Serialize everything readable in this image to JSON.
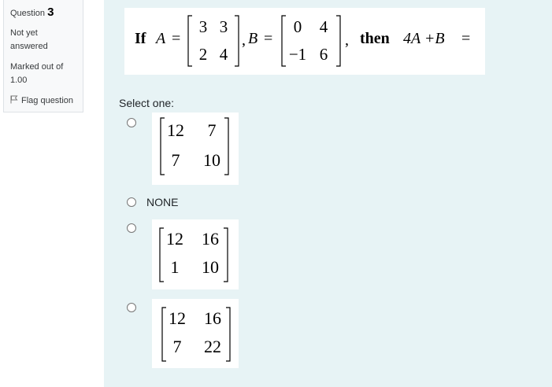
{
  "info": {
    "question_label": "Question",
    "question_number": "3",
    "state_line1": "Not yet",
    "state_line2": "answered",
    "grade_line1": "Marked out of",
    "grade_line2": "1.00",
    "flag_label": "Flag question"
  },
  "question": {
    "if_word": "If",
    "var_a": "A",
    "eq": "=",
    "matrix_a": [
      [
        "3",
        "3"
      ],
      [
        "2",
        "4"
      ]
    ],
    "comma_b": ",",
    "var_b": "B",
    "matrix_b": [
      [
        "0",
        "4"
      ],
      [
        "−1",
        "6"
      ]
    ],
    "comma_then": ",",
    "then_word": "then",
    "expression": "4A +B",
    "final_eq": "="
  },
  "prompt": "Select one:",
  "options": [
    {
      "type": "matrix",
      "matrix": [
        [
          "12",
          "7"
        ],
        [
          "7",
          "10"
        ]
      ]
    },
    {
      "type": "text",
      "label": "NONE"
    },
    {
      "type": "matrix",
      "matrix": [
        [
          "12",
          "16"
        ],
        [
          "1",
          "10"
        ]
      ]
    },
    {
      "type": "matrix",
      "matrix": [
        [
          "12",
          "16"
        ],
        [
          "7",
          "22"
        ]
      ]
    }
  ]
}
